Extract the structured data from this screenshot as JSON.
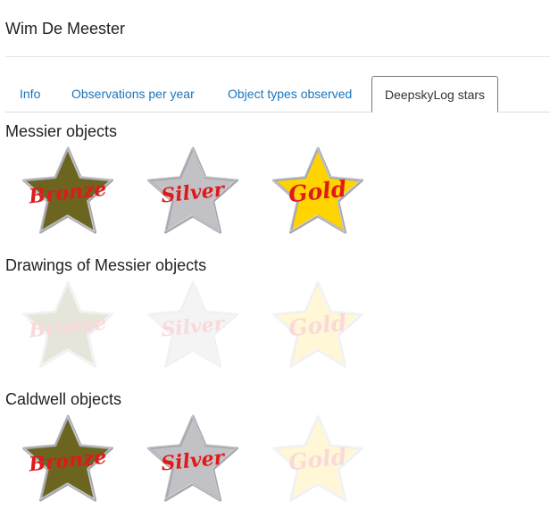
{
  "user": {
    "name": "Wim De Meester"
  },
  "tabs": [
    {
      "label": "Info",
      "active": false
    },
    {
      "label": "Observations per year",
      "active": false
    },
    {
      "label": "Object types observed",
      "active": false
    },
    {
      "label": "DeepskyLog stars",
      "active": true
    }
  ],
  "colors": {
    "bronze": "#6b6520",
    "silver": "#c2c2c6",
    "gold": "#ffd400",
    "label": "#e01a1a",
    "link": "#1b75bb"
  },
  "sections": [
    {
      "title": "Messier objects",
      "stars": [
        {
          "label": "Bronze",
          "achieved": true
        },
        {
          "label": "Silver",
          "achieved": true
        },
        {
          "label": "Gold",
          "achieved": true
        }
      ]
    },
    {
      "title": "Drawings of Messier objects",
      "stars": [
        {
          "label": "Bronze",
          "achieved": false
        },
        {
          "label": "Silver",
          "achieved": false
        },
        {
          "label": "Gold",
          "achieved": false
        }
      ]
    },
    {
      "title": "Caldwell objects",
      "stars": [
        {
          "label": "Bronze",
          "achieved": true
        },
        {
          "label": "Silver",
          "achieved": true
        },
        {
          "label": "Gold",
          "achieved": false
        }
      ]
    }
  ]
}
